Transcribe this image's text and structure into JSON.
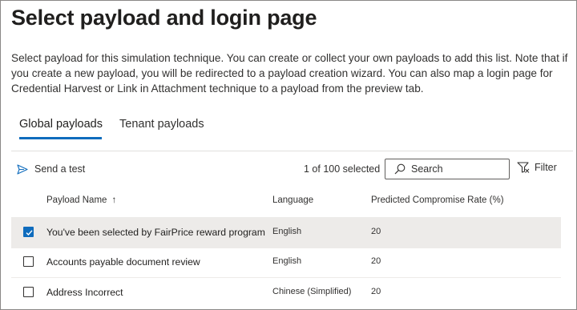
{
  "title": "Select payload and login page",
  "description": "Select payload for this simulation technique. You can create or collect your own payloads to add this list. Note that if you create a new payload, you will be redirected to a payload creation wizard. You can also map a login page for Credential Harvest or Link in Attachment technique to a payload from the preview tab.",
  "tabs": [
    {
      "label": "Global payloads",
      "active": true
    },
    {
      "label": "Tenant payloads",
      "active": false
    }
  ],
  "toolbar": {
    "send_test_label": "Send a test",
    "send_test_icon": "send-icon",
    "selection_count": "1 of 100 selected",
    "search_placeholder": "Search",
    "search_icon": "search-icon",
    "filter_label": "Filter",
    "filter_icon": "filter-icon"
  },
  "table": {
    "columns": {
      "name": "Payload Name",
      "name_sort": "↑",
      "language": "Language",
      "rate": "Predicted Compromise Rate (%)"
    },
    "rows": [
      {
        "name": "You've been selected by FairPrice reward program",
        "language": "English",
        "rate": "20",
        "selected": true
      },
      {
        "name": "Accounts payable document review",
        "language": "English",
        "rate": "20",
        "selected": false
      },
      {
        "name": "Address Incorrect",
        "language": "Chinese (Simplified)",
        "rate": "20",
        "selected": false
      }
    ]
  },
  "colors": {
    "accent": "#0f6cbd",
    "selected_row": "#edebe9"
  }
}
